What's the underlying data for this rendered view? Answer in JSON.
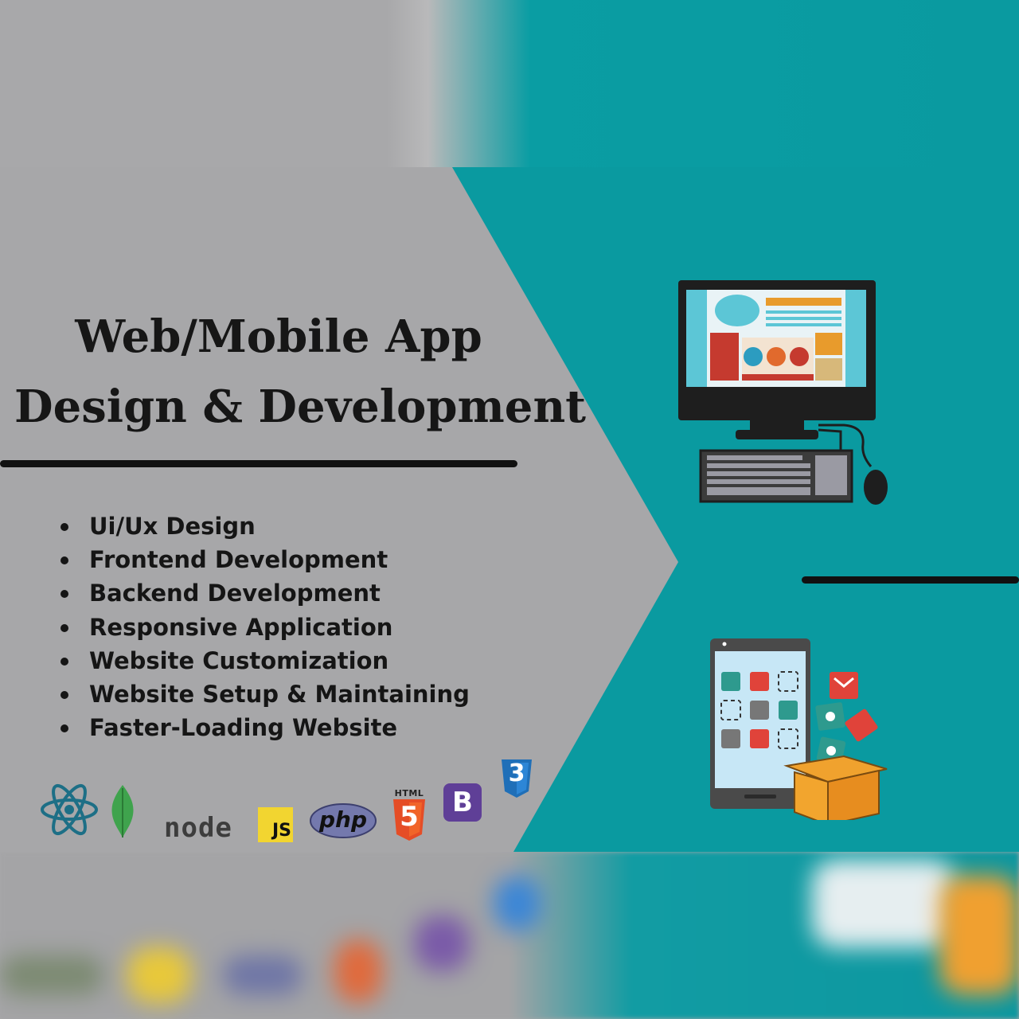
{
  "heading": {
    "line1": "Web/Mobile App",
    "line2": "Design & Development"
  },
  "services": [
    "Ui/Ux Design",
    "Frontend Development",
    "Backend Development",
    "Responsive Application",
    "Website Customization",
    "Website Setup & Maintaining",
    "Faster-Loading Website"
  ],
  "logos": {
    "node": "node",
    "js": "JS",
    "php": "php",
    "html": "HTML",
    "html_num": "5",
    "bootstrap": "B",
    "css_num": "3"
  },
  "colors": {
    "teal": "#0a9aa0",
    "gray": "#a7a7a9",
    "text": "#151515"
  }
}
